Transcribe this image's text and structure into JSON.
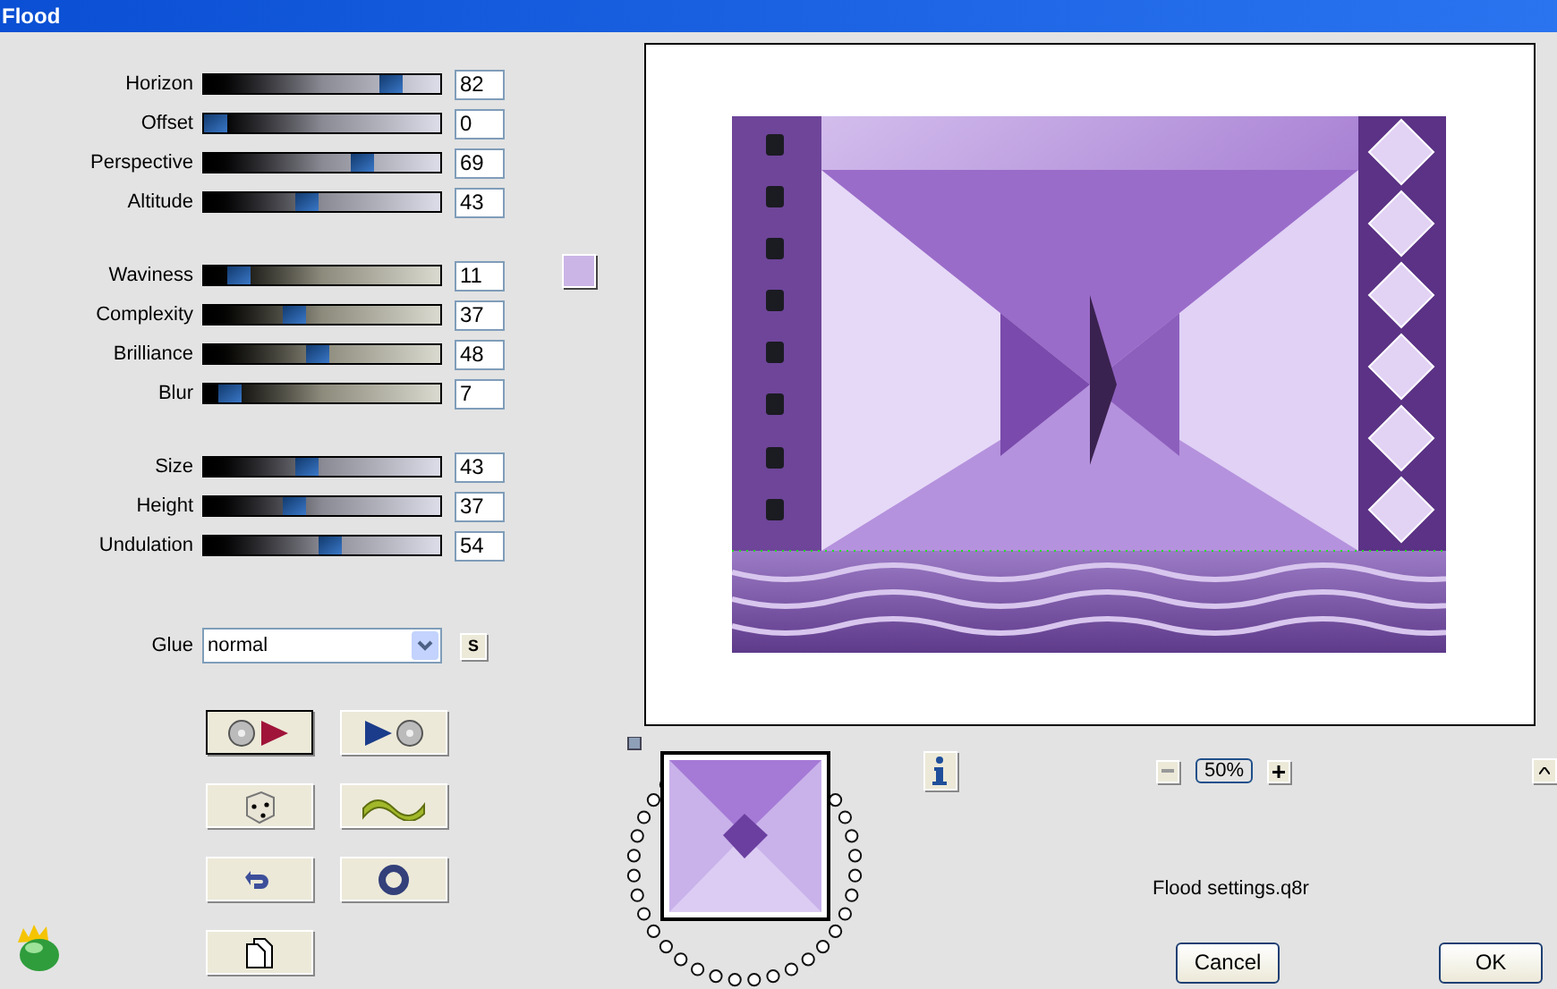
{
  "window": {
    "title": "Flood"
  },
  "slider_groups": [
    {
      "kind": "gray",
      "sliders": [
        {
          "label": "Horizon",
          "value": "82",
          "level": 0.82
        },
        {
          "label": "Offset",
          "value": "0",
          "level": 0
        },
        {
          "label": "Perspective",
          "value": "69",
          "level": 0.69
        },
        {
          "label": "Altitude",
          "value": "43",
          "level": 0.43
        }
      ]
    },
    {
      "kind": "beige",
      "sliders": [
        {
          "label": "Waviness",
          "value": "11",
          "level": 0.11
        },
        {
          "label": "Complexity",
          "value": "37",
          "level": 0.37
        },
        {
          "label": "Brilliance",
          "value": "48",
          "level": 0.48
        },
        {
          "label": "Blur",
          "value": "7",
          "level": 0.07
        }
      ]
    },
    {
      "kind": "gray",
      "sliders": [
        {
          "label": "Size",
          "value": "43",
          "level": 0.43
        },
        {
          "label": "Height",
          "value": "37",
          "level": 0.37
        },
        {
          "label": "Undulation",
          "value": "54",
          "level": 0.54
        }
      ]
    }
  ],
  "color_swatch": {
    "color": "#cbb5e6"
  },
  "glue": {
    "label": "Glue",
    "value": "normal",
    "button": "S"
  },
  "tool_buttons": [
    {
      "kind": "load",
      "default": true
    },
    {
      "kind": "save",
      "default": false
    },
    {
      "kind": "random",
      "default": false
    },
    {
      "kind": "wave",
      "default": false
    },
    {
      "kind": "reset",
      "default": false
    },
    {
      "kind": "ring",
      "default": false
    },
    {
      "kind": "copy",
      "default": false
    }
  ],
  "zoom": {
    "value": "50%"
  },
  "preset_file": "Flood settings.q8r",
  "buttons": [
    "Cancel",
    "OK"
  ]
}
